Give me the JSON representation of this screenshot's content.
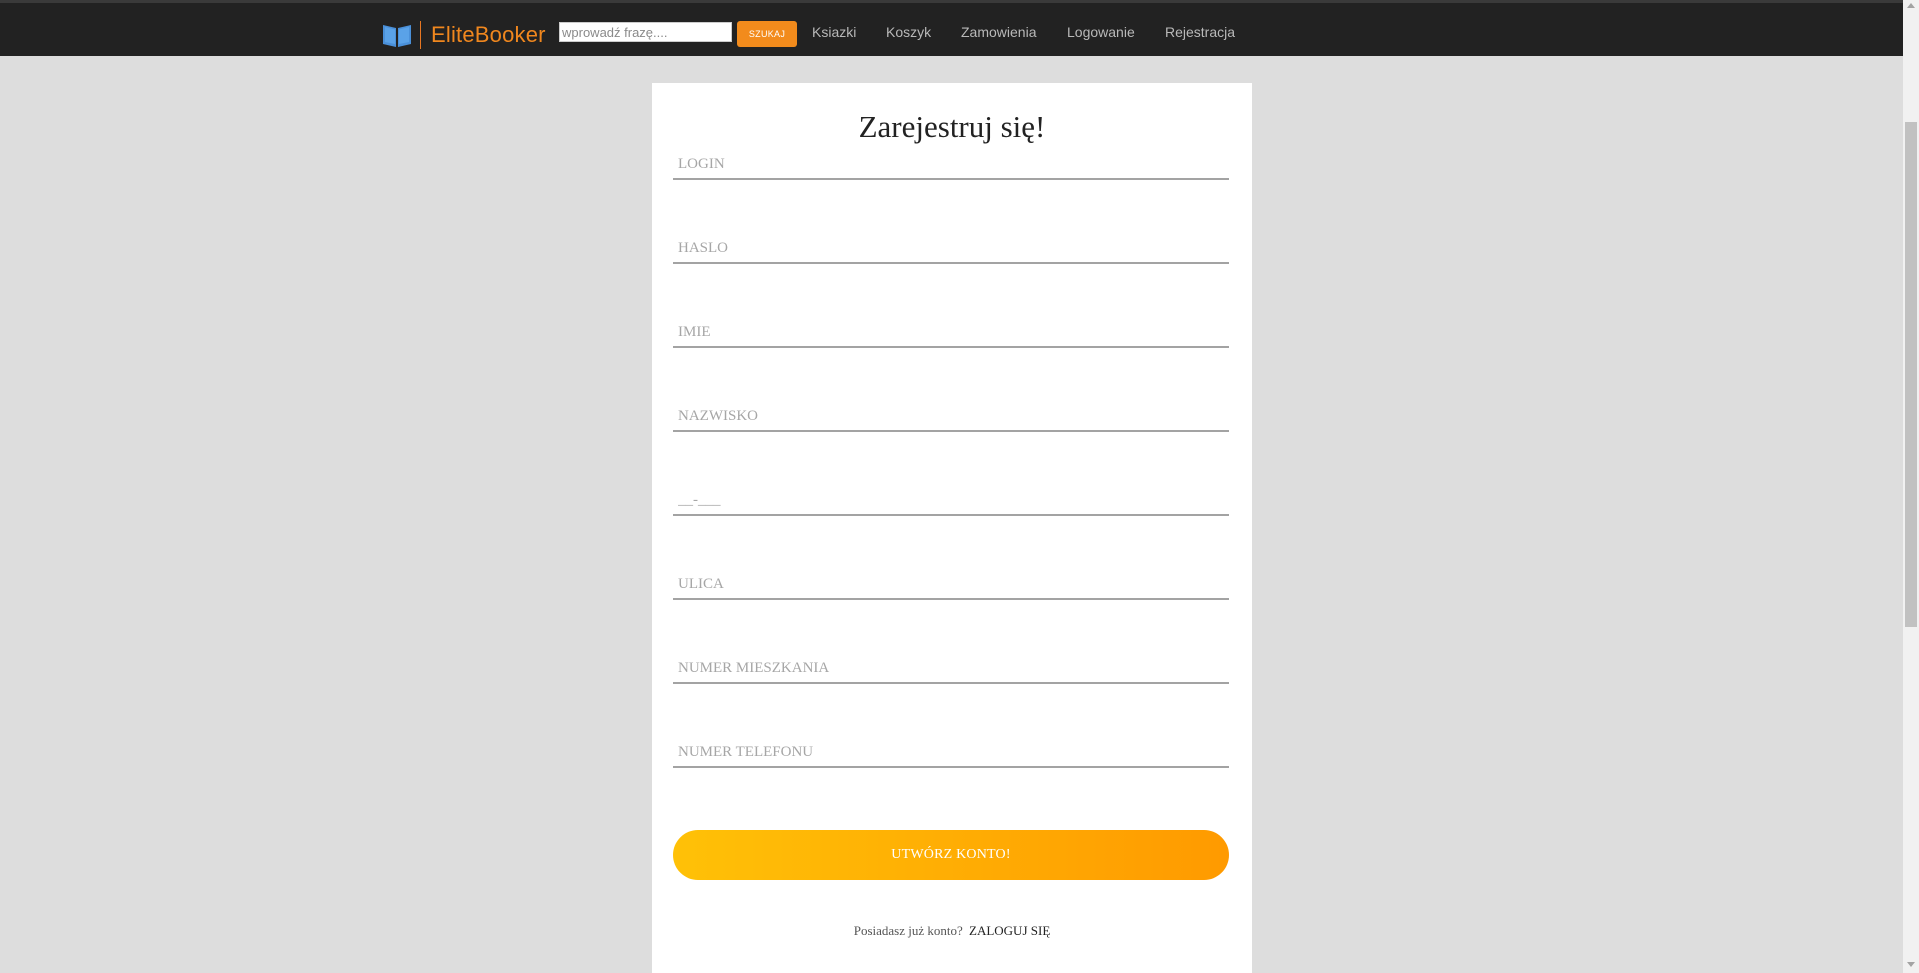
{
  "header": {
    "brand_name": "EliteBooker",
    "brand_color": "#f0871e",
    "logo_icon": "open-book-icon",
    "search": {
      "placeholder": "wprowadź frazę....",
      "value": "",
      "button_label": "SZUKAJ"
    },
    "nav": [
      {
        "label": "Ksiazki"
      },
      {
        "label": "Koszyk"
      },
      {
        "label": "Zamowienia"
      },
      {
        "label": "Logowanie"
      },
      {
        "label": "Rejestracja"
      }
    ]
  },
  "form": {
    "title": "Zarejestruj się!",
    "fields": [
      {
        "placeholder": "LOGIN",
        "value": ""
      },
      {
        "placeholder": "HASLO",
        "value": ""
      },
      {
        "placeholder": "IMIE",
        "value": ""
      },
      {
        "placeholder": "NAZWISKO",
        "value": ""
      },
      {
        "placeholder": "__-___",
        "value": ""
      },
      {
        "placeholder": "ULICA",
        "value": ""
      },
      {
        "placeholder": "NUMER MIESZKANIA",
        "value": ""
      },
      {
        "placeholder": "NUMER TELEFONU",
        "value": ""
      }
    ],
    "submit_label": "UTWÓRZ KONTO!",
    "login_prompt": "Posiadasz już konto?",
    "login_link": "ZALOGUJ SIĘ"
  },
  "colors": {
    "topbar": "#222222",
    "page_background": "#dddddd",
    "search_button": "#f28b1c",
    "submit_gradient_start": "#ffc107",
    "submit_gradient_end": "#ff9a00"
  }
}
